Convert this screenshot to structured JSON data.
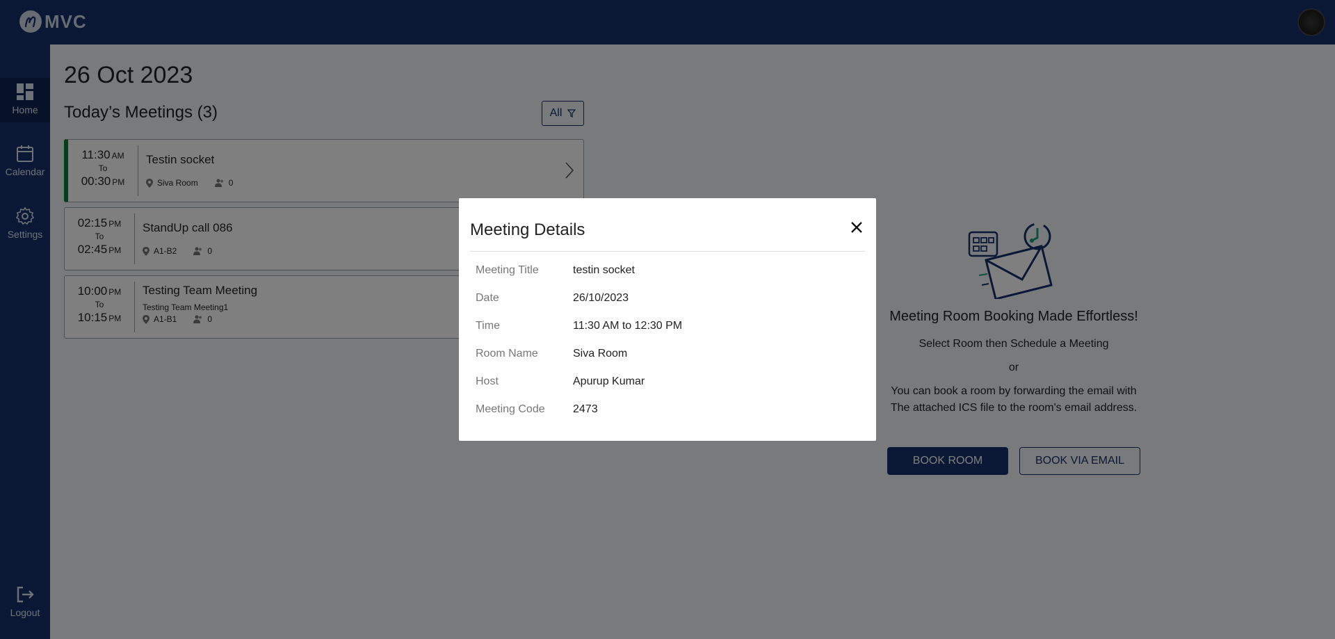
{
  "app": {
    "logo_text": "MVC"
  },
  "sidebar": {
    "items": [
      {
        "label": "Home"
      },
      {
        "label": "Calendar"
      },
      {
        "label": "Settings"
      },
      {
        "label": "Logout"
      }
    ]
  },
  "main": {
    "date": "26 Oct 2023",
    "section_title": "Today’s Meetings (3)",
    "filter_label": "All",
    "meetings": [
      {
        "start": "11:30",
        "start_ampm": "AM",
        "to": "To",
        "end": "00:30",
        "end_ampm": "PM",
        "title": "Testin socket",
        "subtitle": "",
        "room": "Siva Room",
        "attendees": "0"
      },
      {
        "start": "02:15",
        "start_ampm": "PM",
        "to": "To",
        "end": "02:45",
        "end_ampm": "PM",
        "title": "StandUp call 086",
        "subtitle": "",
        "room": "A1-B2",
        "attendees": "0"
      },
      {
        "start": "10:00",
        "start_ampm": "PM",
        "to": "To",
        "end": "10:15",
        "end_ampm": "PM",
        "title": "Testing Team Meeting",
        "subtitle": "Testing Team Meeting1",
        "room": "A1-B1",
        "attendees": "0"
      }
    ]
  },
  "info_panel": {
    "heading": "Meeting Room Booking Made Effortless!",
    "line1": "Select Room then Schedule a Meeting",
    "or": "or",
    "line2a": "You can book a room by forwarding the email with",
    "line2b": "The attached ICS file to the room's email address.",
    "book_room": "BOOK ROOM",
    "book_via_email": "BOOK VIA EMAIL"
  },
  "modal": {
    "title": "Meeting Details",
    "rows": [
      {
        "label": "Meeting Title",
        "value": "testin socket"
      },
      {
        "label": "Date",
        "value": "26/10/2023"
      },
      {
        "label": "Time",
        "value": "11:30 AM to 12:30 PM"
      },
      {
        "label": "Room Name",
        "value": "Siva Room"
      },
      {
        "label": "Host",
        "value": "Apurup Kumar"
      },
      {
        "label": "Meeting Code",
        "value": "2473"
      }
    ]
  },
  "colors": {
    "brand": "#14316a",
    "active_meeting": "#0a7a3a"
  },
  "icons": [
    "logo-icon",
    "avatar",
    "home-icon",
    "calendar-icon",
    "settings-icon",
    "logout-icon",
    "filter-icon",
    "location-icon",
    "people-icon",
    "chevron-right-icon",
    "close-icon"
  ]
}
